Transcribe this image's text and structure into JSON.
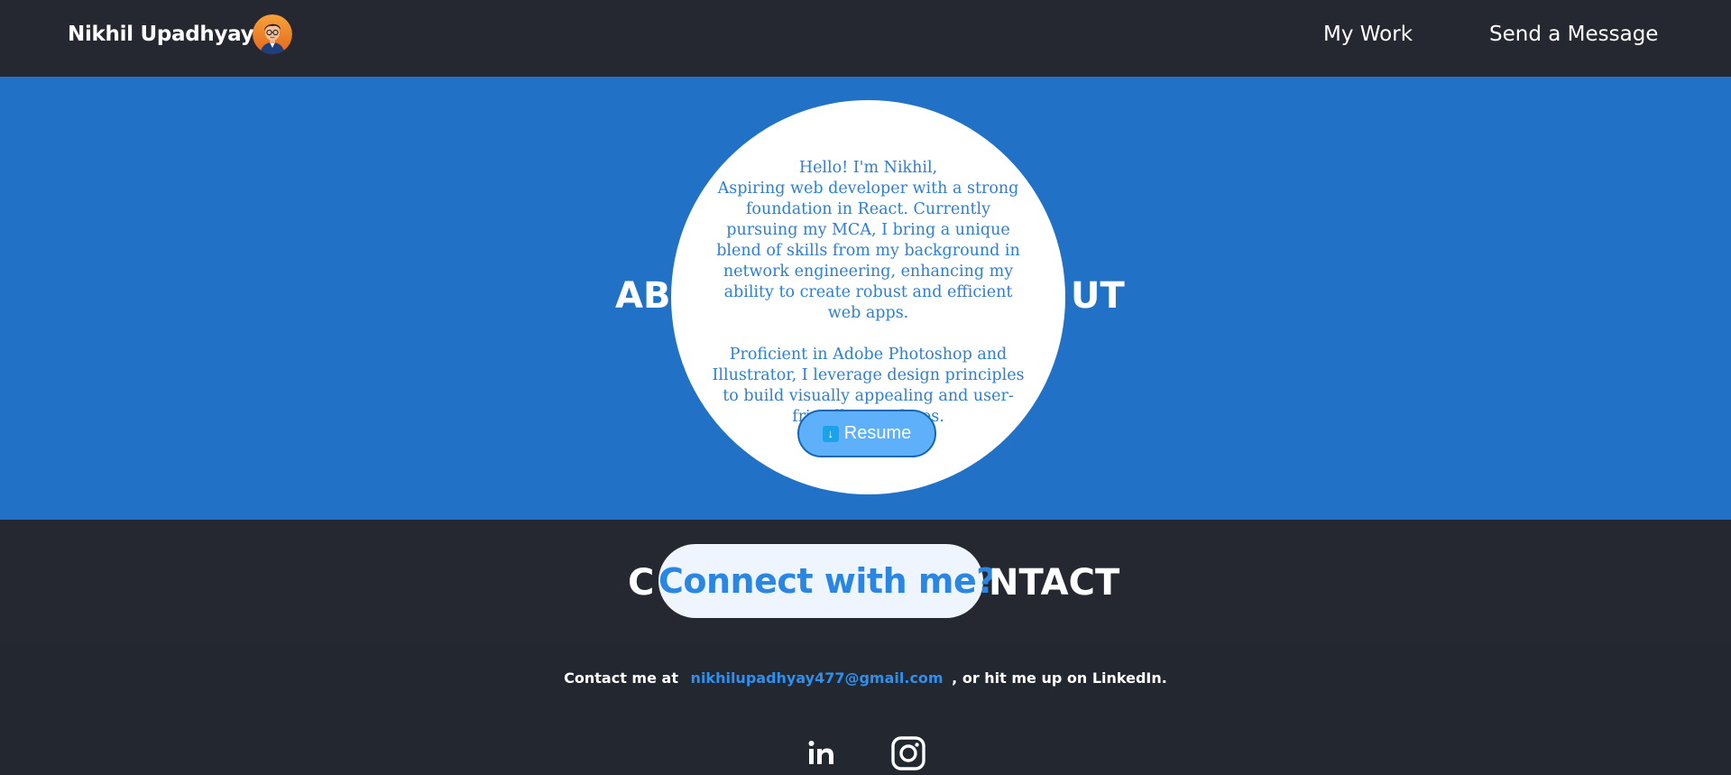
{
  "header": {
    "brand_name": "Nikhil Upadhyay",
    "nav": [
      {
        "label": "My Work"
      },
      {
        "label": "Send a Message"
      }
    ]
  },
  "about": {
    "heading_left": "AB",
    "heading_right": "UT",
    "paragraph_1": "Hello! I'm Nikhil,\nAspiring web developer with a strong foundation in React. Currently pursuing my MCA, I bring a unique blend of skills from my background in network engineering, enhancing my ability to create robust and efficient web apps.",
    "paragraph_2": "Proficient in Adobe Photoshop and Illustrator, I leverage design principles to build visually appealing and user-friendly interfaces.",
    "resume_label": "Resume",
    "resume_icon": "download-arrow-icon"
  },
  "contact": {
    "heading_left": "C",
    "heading_right": "NTACT",
    "pill_text": "Connect with me?",
    "prefix": "Contact me at",
    "email": "nikhilupadhyay477@gmail.com",
    "suffix": ", or hit me up on LinkedIn.",
    "social": [
      {
        "icon": "linkedin-icon"
      },
      {
        "icon": "instagram-icon"
      }
    ]
  },
  "colors": {
    "navbar_bg": "#252831",
    "about_bg": "#2172c7",
    "accent_blue": "#2a86e3",
    "resume_button": "#5fb0fb"
  }
}
